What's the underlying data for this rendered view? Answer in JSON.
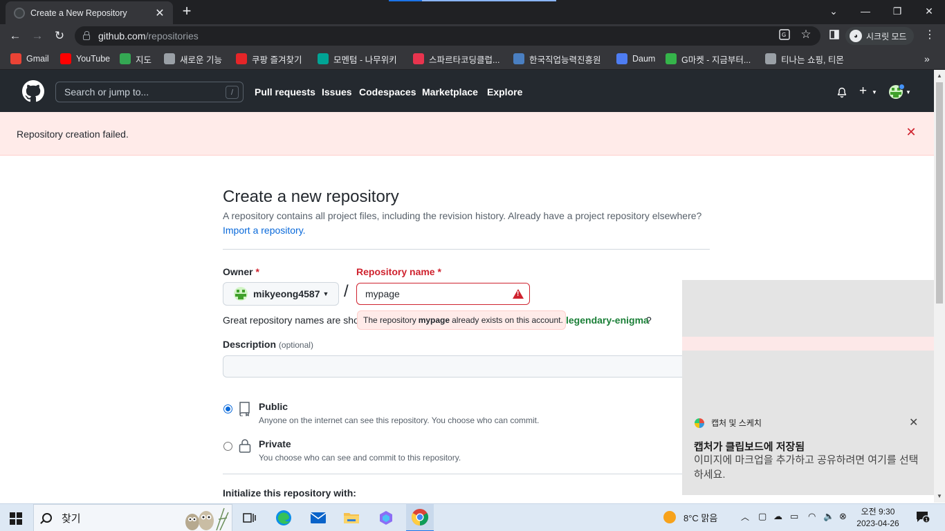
{
  "browser": {
    "tab_title": "Create a New Repository",
    "url_host": "github.com",
    "url_path": "/repositories",
    "incognito_label": "시크릿 모드",
    "bookmarks": [
      {
        "label": "Gmail",
        "icon": "gmail-icon",
        "color": "#ea4335"
      },
      {
        "label": "YouTube",
        "icon": "youtube-icon",
        "color": "#ff0000"
      },
      {
        "label": "지도",
        "icon": "maps-icon",
        "color": "#34a853"
      },
      {
        "label": "새로운 기능",
        "icon": "chrome-icon",
        "color": "#9aa0a6"
      },
      {
        "label": "쿠팡 즐겨찾기",
        "icon": "coupang-icon",
        "color": "#e52528"
      },
      {
        "label": "모멘텀 - 나무위키",
        "icon": "namuwiki-icon",
        "color": "#00a495"
      },
      {
        "label": "스파르타코딩클럽...",
        "icon": "sparta-icon",
        "color": "#e8344e"
      },
      {
        "label": "한국직업능력진흥원",
        "icon": "hrdk-icon",
        "color": "#4a7fc1"
      },
      {
        "label": "Daum",
        "icon": "daum-icon",
        "color": "#4e7df2"
      },
      {
        "label": "G마켓 - 지금부터...",
        "icon": "gmarket-icon",
        "color": "#35b44a"
      },
      {
        "label": "티나는 쇼핑, 티몬",
        "icon": "globe-icon",
        "color": "#9aa0a6"
      }
    ]
  },
  "github": {
    "search_placeholder": "Search or jump to...",
    "search_shortcut": "/",
    "nav": [
      "Pull requests",
      "Issues",
      "Codespaces",
      "Marketplace",
      "Explore"
    ],
    "flash_message": "Repository creation failed."
  },
  "form": {
    "title": "Create a new repository",
    "subtitle": "A repository contains all project files, including the revision history. Already have a project repository elsewhere?",
    "import_link": "Import a repository.",
    "owner_label": "Owner",
    "owner_value": "mikyeong4587",
    "required_mark": "*",
    "repo_label": "Repository name",
    "repo_value": "mypage",
    "separator": "/",
    "hint_prefix": "Great repository names are sho",
    "tooltip_prefix": "The repository",
    "tooltip_name": "mypage",
    "tooltip_suffix": "already exists on this account.",
    "suggestion": "legendary-enigma",
    "suggestion_suffix": "?",
    "description_label": "Description",
    "description_optional": "(optional)",
    "description_value": "",
    "visibility": [
      {
        "title": "Public",
        "desc": "Anyone on the internet can see this repository. You choose who can commit.",
        "checked": true
      },
      {
        "title": "Private",
        "desc": "You choose who can see and commit to this repository.",
        "checked": false
      }
    ],
    "init_label": "Initialize this repository with:"
  },
  "toast": {
    "app_name": "캡처 및 스케치",
    "title": "캡처가 클립보드에 저장됨",
    "body": "이미지에 마크업을 추가하고 공유하려면 여기를 선택하세요."
  },
  "taskbar": {
    "search_placeholder": "찾기",
    "weather": "8°C  맑음",
    "time": "오전 9:30",
    "date": "2023-04-26",
    "notification_count": "1"
  }
}
